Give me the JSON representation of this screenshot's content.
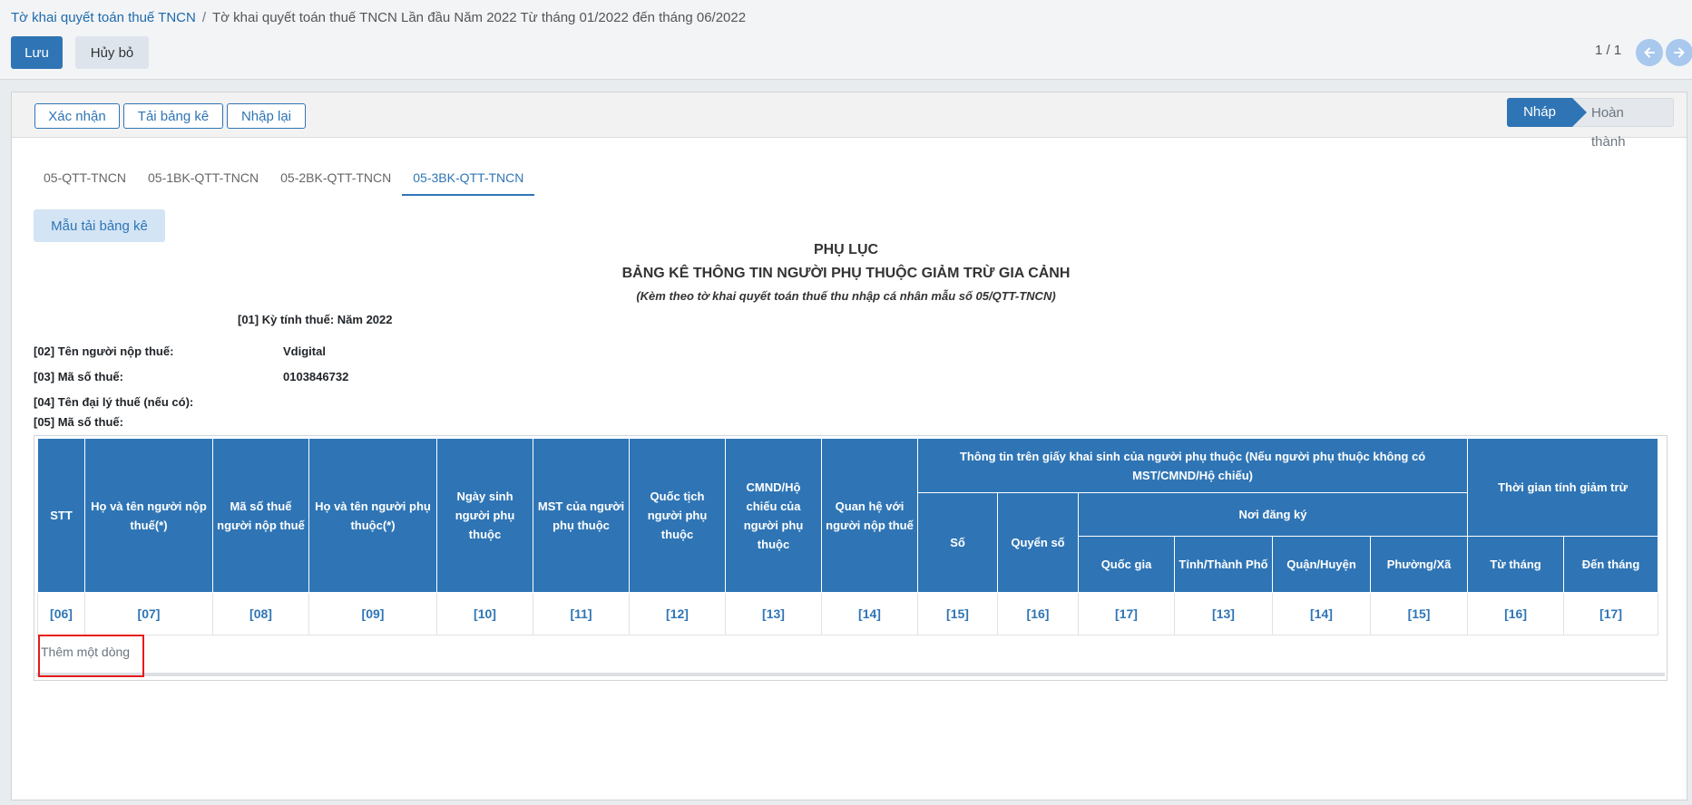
{
  "breadcrumb": {
    "parent": "Tờ khai quyết toán thuế TNCN",
    "separator": "/",
    "current": "Tờ khai quyết toán thuế TNCN Lần đầu Năm 2022 Từ tháng 01/2022 đến tháng 06/2022"
  },
  "buttons": {
    "save": "Lưu",
    "discard": "Hủy bỏ"
  },
  "pager": {
    "value": "1 / 1"
  },
  "header_buttons": {
    "confirm": "Xác nhận",
    "import": "Tải bảng kê",
    "reset": "Nhập lại"
  },
  "status": {
    "draft": "Nháp",
    "done": "Hoàn thành",
    "current": "draft"
  },
  "tabs": [
    {
      "label": "05-QTT-TNCN",
      "active": false
    },
    {
      "label": "05-1BK-QTT-TNCN",
      "active": false
    },
    {
      "label": "05-2BK-QTT-TNCN",
      "active": false
    },
    {
      "label": "05-3BK-QTT-TNCN",
      "active": true
    }
  ],
  "template_button": "Mẫu tải bảng kê",
  "document": {
    "title1": "PHỤ LỤC",
    "title2": "BẢNG KÊ THÔNG TIN NGƯỜI PHỤ THUỘC GIẢM TRỪ GIA CẢNH",
    "subtitle": "(Kèm theo tờ khai quyết toán thuế thu nhập cá nhân mẫu số 05/QTT-TNCN)",
    "period": "[01] Kỳ tính thuế: Năm 2022",
    "taxpayer_name_label": "[02] Tên người nộp thuế:",
    "taxpayer_name": "Vdigital",
    "tax_code_label": "[03] Mã số thuế:",
    "tax_code": "0103846732",
    "agent_name_label": "[04] Tên đại lý thuế (nếu có):",
    "agent_tax_code_label": "[05] Mã số thuế:"
  },
  "table": {
    "headers": {
      "stt": "STT",
      "taxpayer_name": "Họ và tên người nộp thuế(*)",
      "taxpayer_code": "Mã số thuế người nộp thuế",
      "dependent_name": "Họ và tên người phụ thuộc(*)",
      "birth_date": "Ngày sinh người phụ thuộc",
      "dependent_tax_code": "MST của người phụ thuộc",
      "nationality": "Quốc tịch người phụ thuộc",
      "id_number": "CMND/Hộ chiếu của người phụ thuộc",
      "relationship": "Quan hệ với người nộp thuế",
      "birth_cert_group": "Thông tin trên giấy khai sinh của người phụ thuộc (Nếu người phụ thuộc không có MST/CMND/Hộ chiếu)",
      "number": "Số",
      "book": "Quyển số",
      "registration_group": "Nơi đăng ký",
      "country": "Quốc gia",
      "province": "Tỉnh/Thành Phố",
      "district": "Quận/Huyện",
      "ward": "Phường/Xã",
      "deduction_group": "Thời gian tính giảm trừ",
      "from_month": "Từ tháng",
      "to_month": "Đến tháng"
    },
    "codes": [
      "[06]",
      "[07]",
      "[08]",
      "[09]",
      "[10]",
      "[11]",
      "[12]",
      "[13]",
      "[14]",
      "[15]",
      "[16]",
      "[17]",
      "[13]",
      "[14]",
      "[15]",
      "[16]",
      "[17]"
    ],
    "add_row": "Thêm một dòng"
  }
}
